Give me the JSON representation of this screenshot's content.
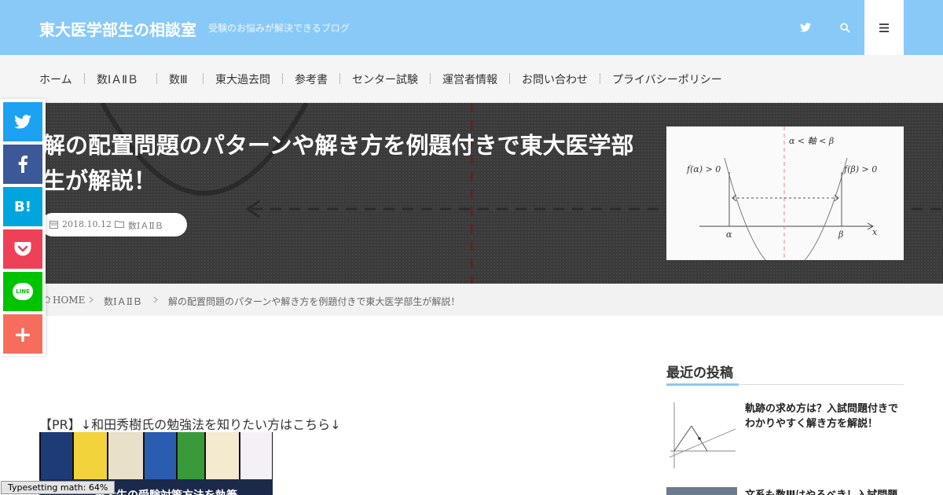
{
  "header": {
    "site_title": "東大医学部生の相談室",
    "site_description": "受験のお悩みが解決できるブログ",
    "icons": [
      "twitter-icon",
      "search-icon",
      "menu-icon"
    ],
    "bg_color": "#89c9f7"
  },
  "nav": {
    "items": [
      "ホーム",
      "数ⅠＡⅡＢ",
      "数Ⅲ",
      "東大過去問",
      "参考書",
      "センター試験",
      "運営者情報",
      "お問い合わせ",
      "プライバシーポリシー"
    ]
  },
  "article": {
    "title": "解の配置問題のパターンや解き方を例題付きで東大医学部生が解説！",
    "date": "2018.10.12",
    "category": "数ⅠＡⅡＢ",
    "thumbnail_labels": {
      "axis_condition": "α < 軸 < β",
      "f_alpha": "f(α) > 0",
      "f_beta": "f(β) > 0",
      "alpha": "α",
      "beta": "β",
      "x": "x"
    }
  },
  "breadcrumb": {
    "home": "HOME",
    "category": "数ⅠＡⅡＢ",
    "current": "解の配置問題のパターンや解き方を例題付きで東大医学部生が解説！"
  },
  "share": [
    {
      "name": "twitter",
      "label": "",
      "color": "#1da1f2"
    },
    {
      "name": "facebook",
      "label": "",
      "color": "#3b5998"
    },
    {
      "name": "hatena",
      "label": "B!",
      "color": "#00a4de"
    },
    {
      "name": "pocket",
      "label": "",
      "color": "#ee4056"
    },
    {
      "name": "line",
      "label": "LINE",
      "color": "#00c300"
    },
    {
      "name": "more",
      "label": "+",
      "color": "#f66d5d"
    }
  ],
  "content": {
    "pr_text": "【PR】↓和田秀樹氏の勉強法を知りたい方はこちら↓",
    "books_caption": "東大生の受験対策方法を執筆",
    "mathjax_status": "Typesetting math: 64%"
  },
  "sidebar": {
    "heading": "最近の投稿",
    "posts": [
      {
        "title": "軌跡の求め方は？入試問題付きでわかりやすく解き方を解説！"
      },
      {
        "title": "文系も数Ⅲはやるべき！入試問題"
      }
    ]
  }
}
